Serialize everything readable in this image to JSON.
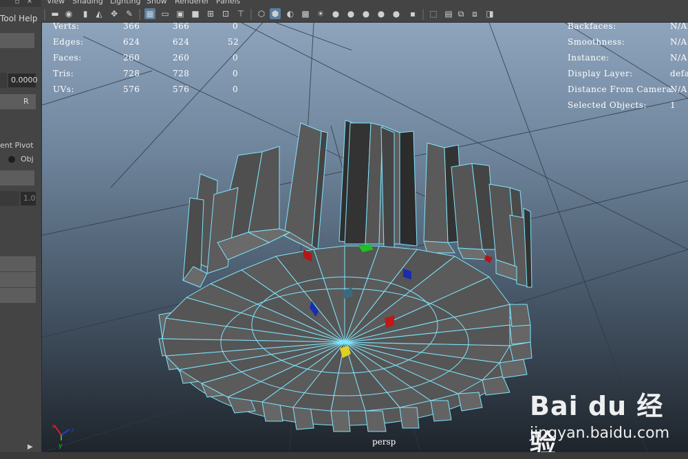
{
  "menu": [
    "View",
    "Shading",
    "Lighting",
    "Show",
    "Renderer",
    "Panels"
  ],
  "left_panel": {
    "title": "Tool Help",
    "field1_value": "0.0000",
    "button_label": "R",
    "pivot_label": "ent Pivot",
    "radio_label": "Obj",
    "field2_value": "1.0"
  },
  "hud_left": {
    "rows": [
      {
        "label": "Verts:",
        "v1": "366",
        "v2": "366",
        "v3": "0"
      },
      {
        "label": "Edges:",
        "v1": "624",
        "v2": "624",
        "v3": "52"
      },
      {
        "label": "Faces:",
        "v1": "260",
        "v2": "260",
        "v3": "0"
      },
      {
        "label": "Tris:",
        "v1": "728",
        "v2": "728",
        "v3": "0"
      },
      {
        "label": "UVs:",
        "v1": "576",
        "v2": "576",
        "v3": "0"
      }
    ]
  },
  "hud_right": {
    "rows": [
      {
        "label": "Backfaces:",
        "value": "N/A"
      },
      {
        "label": "Smoothness:",
        "value": "N/A"
      },
      {
        "label": "Instance:",
        "value": "N/A"
      },
      {
        "label": "Display Layer:",
        "value": "defa"
      },
      {
        "label": "Distance From Camera:",
        "value": "N/A"
      },
      {
        "label": "Selected Objects:",
        "value": "1"
      }
    ]
  },
  "camera_label": "persp",
  "axis": {
    "x": "x",
    "y": "y",
    "z": "z"
  },
  "watermark": {
    "brand": "Bai du 经验",
    "url": "jingyan.baidu.com"
  },
  "colors": {
    "wire": "#7fe6ff",
    "panel": "#444444",
    "selected_icon": "#5a7fa0"
  }
}
